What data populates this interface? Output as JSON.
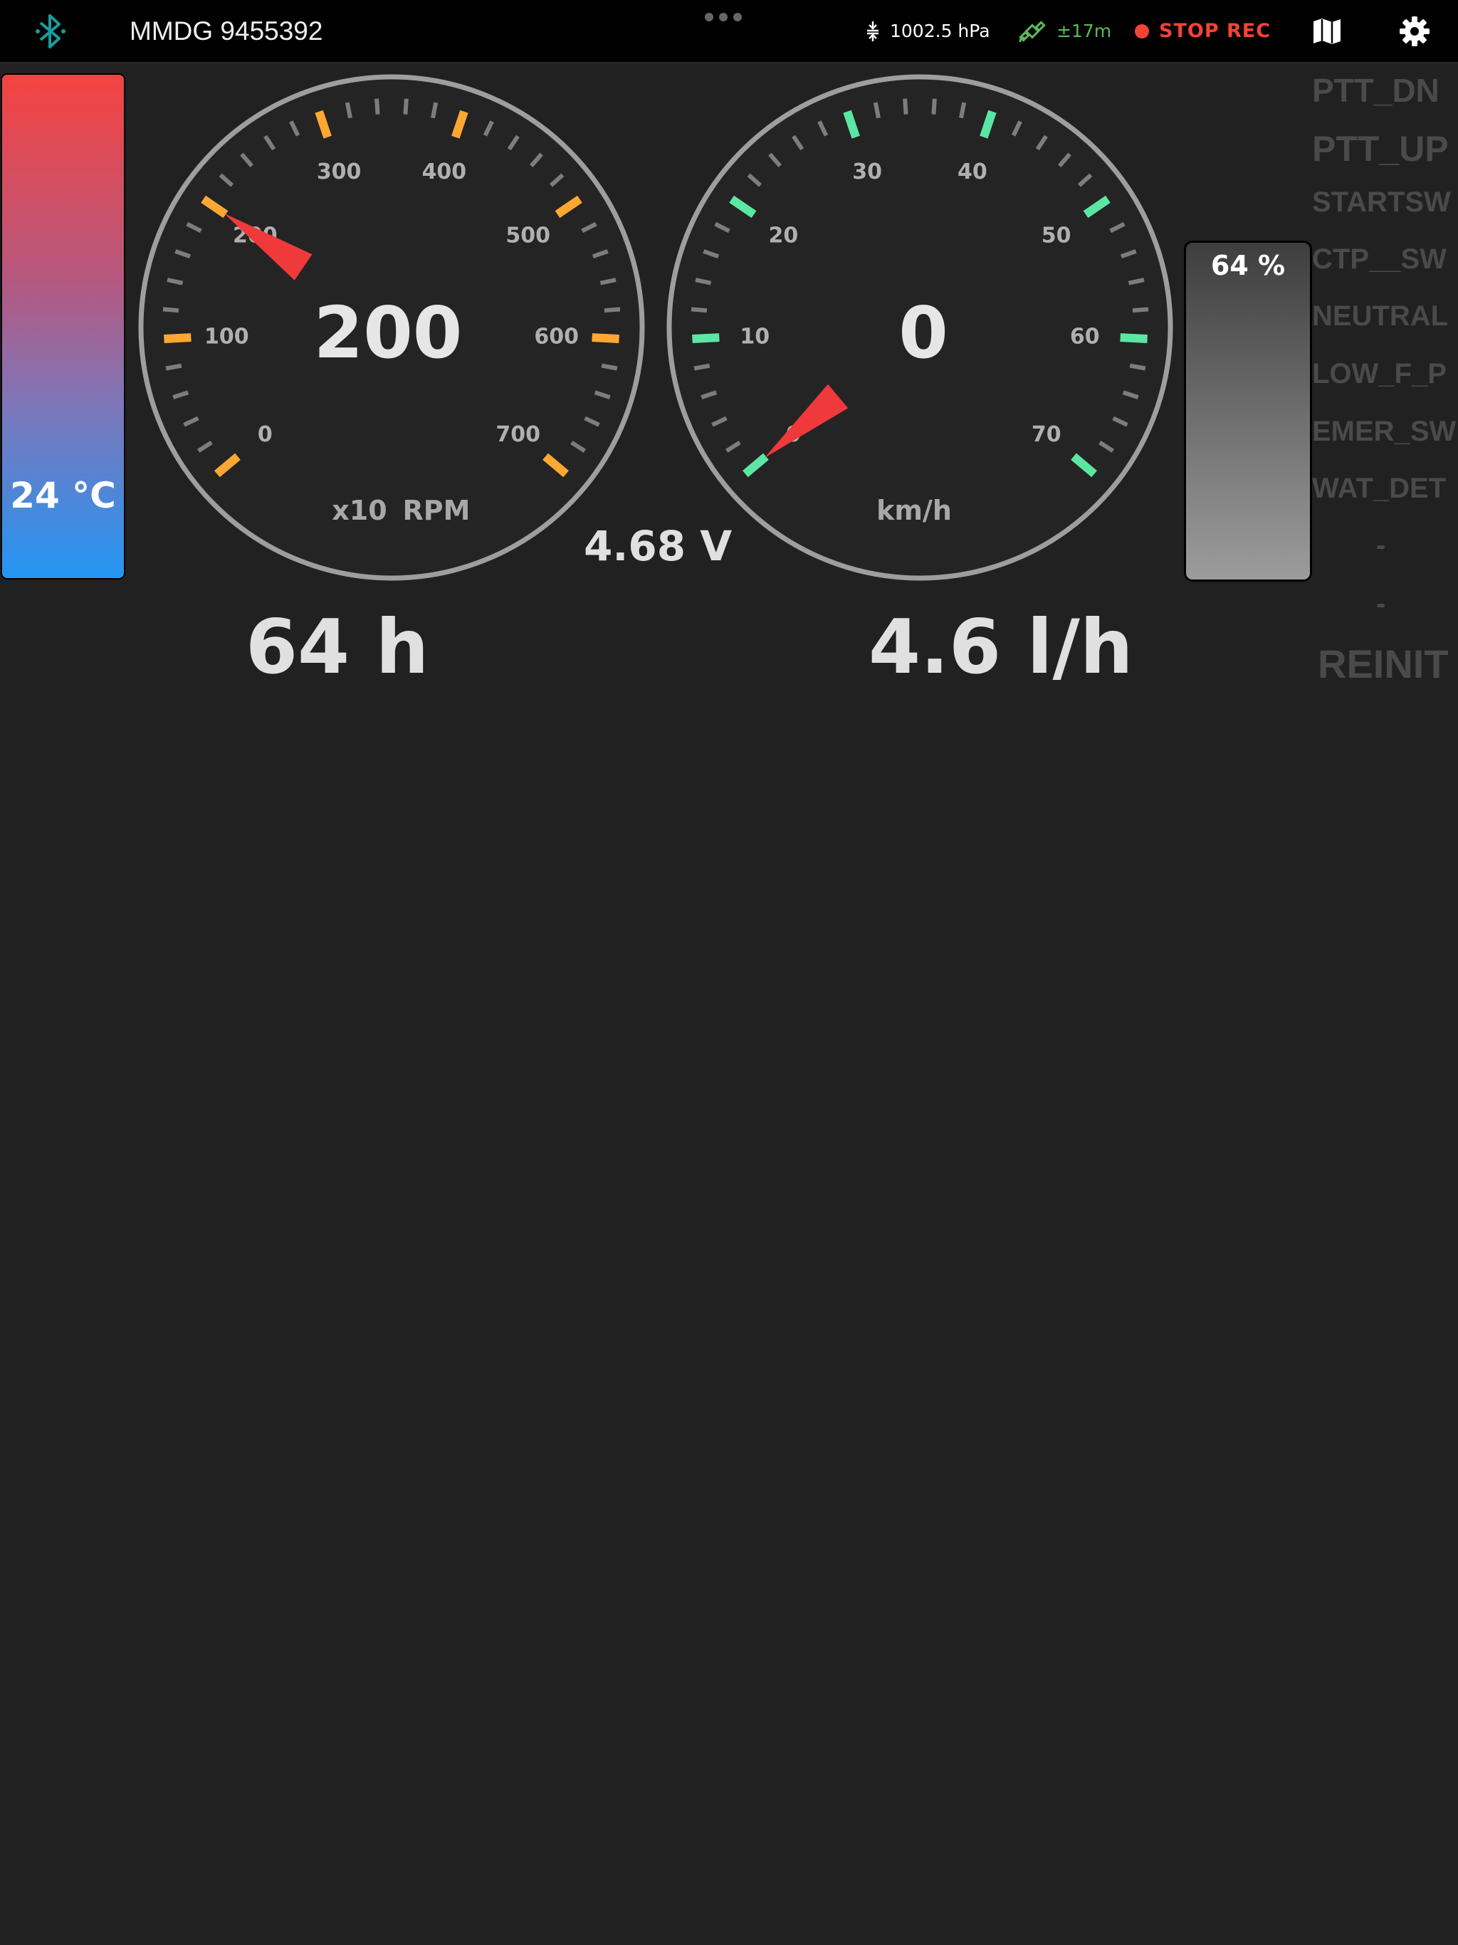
{
  "topbar": {
    "device_name": "MMDG 9455392",
    "pressure": "1002.5 hPa",
    "gps_accuracy": "±17m",
    "record_label": "STOP REC",
    "icons": [
      "bluetooth-icon",
      "drag-handle-icon",
      "pressure-icon",
      "satellite-icon",
      "record-dot-icon",
      "map-icon",
      "gear-icon"
    ],
    "colors": {
      "bluetooth": "#1a9c9c",
      "gps": "#5cb85c",
      "rec": "#f44336"
    }
  },
  "temperature": {
    "label": "24 °C",
    "value_c": 24
  },
  "fuel_level": {
    "label": "64 %",
    "percent": 64
  },
  "rpm_gauge": {
    "value": "200",
    "unit_multiplier": "x10",
    "unit": "RPM",
    "ticks": [
      "0",
      "100",
      "200",
      "300",
      "400",
      "500",
      "600",
      "700"
    ],
    "needle_value": 200,
    "accent": "#ffa733"
  },
  "speed_gauge": {
    "value": "0",
    "unit": "km/h",
    "ticks": [
      "0",
      "10",
      "20",
      "30",
      "40",
      "50",
      "60",
      "70"
    ],
    "needle_value": 0,
    "accent": "#5ce6a3"
  },
  "voltage": "4.68 V",
  "engine_hours": "64 h",
  "fuel_rate": "4.6 l/h",
  "switches": [
    "PTT_DN",
    "PTT_UP",
    "STARTSW",
    "CTP__SW",
    "NEUTRAL",
    "LOW_F_P",
    "EMER_SW",
    "WAT_DET",
    "-",
    "-",
    "REINIT"
  ]
}
